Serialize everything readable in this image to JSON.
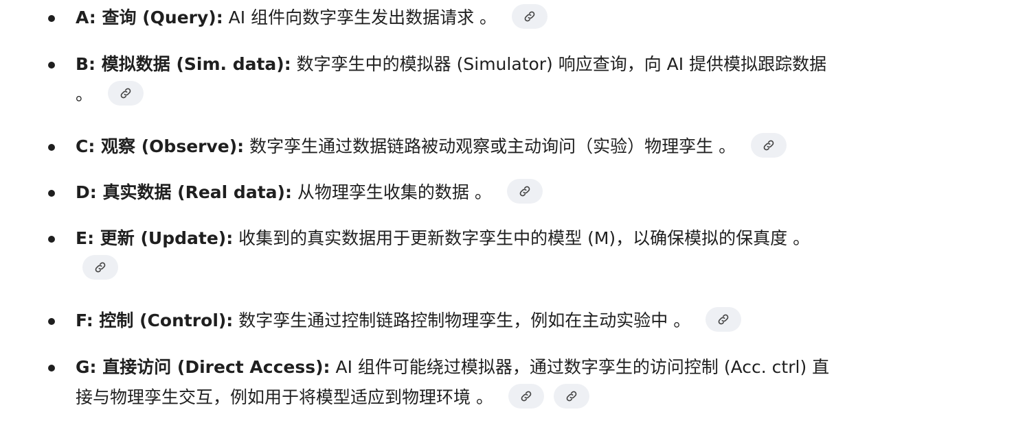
{
  "items": [
    {
      "head": "A: 查询 (Query):",
      "text": " AI 组件向数字孪生发出数据请求 。",
      "links": 1
    },
    {
      "head": "B: 模拟数据 (Sim. data):",
      "text": " 数字孪生中的模拟器 (Simulator) 响应查询，向 AI 提供模拟跟踪数据",
      "text2": "。",
      "links": 1
    },
    {
      "head": "C: 观察 (Observe):",
      "text": " 数字孪生通过数据链路被动观察或主动询问（实验）物理孪生 。",
      "links": 1
    },
    {
      "head": "D: 真实数据 (Real data):",
      "text": " 从物理孪生收集的数据 。",
      "links": 1
    },
    {
      "head": "E: 更新 (Update):",
      "text": " 收集到的真实数据用于更新数字孪生中的模型 (M)，以确保模拟的保真度 。",
      "links": 1
    },
    {
      "head": "F: 控制 (Control):",
      "text": " 数字孪生通过控制链路控制物理孪生，例如在主动实验中 。",
      "links": 1
    },
    {
      "head": "G: 直接访问 (Direct Access):",
      "text": " AI 组件可能绕过模拟器，通过数字孪生的访问控制 (Acc. ctrl) 直",
      "text2": "接与物理孪生交互，例如用于将模型适应到物理环境 。",
      "links": 2
    }
  ],
  "icon": "link-icon"
}
